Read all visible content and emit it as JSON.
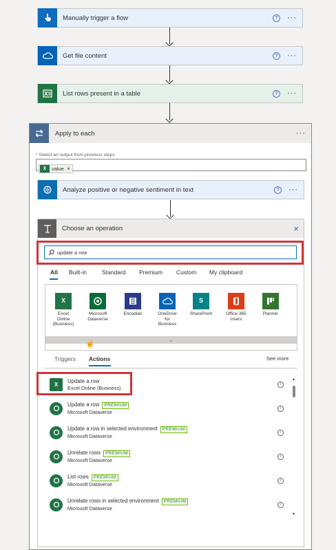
{
  "steps": {
    "trigger": {
      "label": "Manually trigger a flow",
      "color": "#0f6cbd",
      "bg": "#e8f1fb"
    },
    "file": {
      "label": "Get file content",
      "color": "#0364b8",
      "bg": "#e8f1fb"
    },
    "rows": {
      "label": "List rows present in a table",
      "color": "#217346",
      "bg": "#e3f1e8"
    },
    "sentiment": {
      "label": "Analyze positive or negative sentiment in text",
      "color": "#0c6fb0",
      "bg": "#e8f1fb"
    }
  },
  "apply": {
    "title": "Apply to each",
    "field_label": "* Select an output from previous steps",
    "chip_value": "value"
  },
  "operation": {
    "title": "Choose an operation",
    "search_value": "update a row",
    "filter_tabs": [
      "All",
      "Built-in",
      "Standard",
      "Premium",
      "Custom",
      "My clipboard"
    ],
    "connectors": [
      {
        "name": "Excel Online (Business)",
        "icon": "excel-icon"
      },
      {
        "name": "Microsoft Dataverse",
        "icon": "dataverse-icon"
      },
      {
        "name": "Encodian",
        "icon": "encodian-icon"
      },
      {
        "name": "OneDrive for Business",
        "icon": "onedrive-icon"
      },
      {
        "name": "SharePoint",
        "icon": "sharepoint-icon"
      },
      {
        "name": "Office 365 Users",
        "icon": "office-icon"
      },
      {
        "name": "Planner",
        "icon": "planner-icon"
      }
    ],
    "sub_tabs": {
      "triggers": "Triggers",
      "actions": "Actions",
      "see_more": "See more"
    },
    "actions": [
      {
        "title": "Update a row",
        "premium": "",
        "source": "Excel Online (Business)"
      },
      {
        "title": "Update a row",
        "premium": "PREMIUM",
        "source": "Microsoft Dataverse"
      },
      {
        "title": "Update a row in selected environment",
        "premium": "PREMIUM",
        "source": "Microsoft Dataverse"
      },
      {
        "title": "Unrelate rows",
        "premium": "PREMIUM",
        "source": "Microsoft Dataverse"
      },
      {
        "title": "List rows",
        "premium": "PREMIUM",
        "source": "Microsoft Dataverse"
      },
      {
        "title": "Unrelate rows in selected environment",
        "premium": "PREMIUM",
        "source": "Microsoft Dataverse"
      }
    ]
  },
  "colors": {
    "highlight": "#d13438",
    "accent": "#0f6cbd"
  }
}
